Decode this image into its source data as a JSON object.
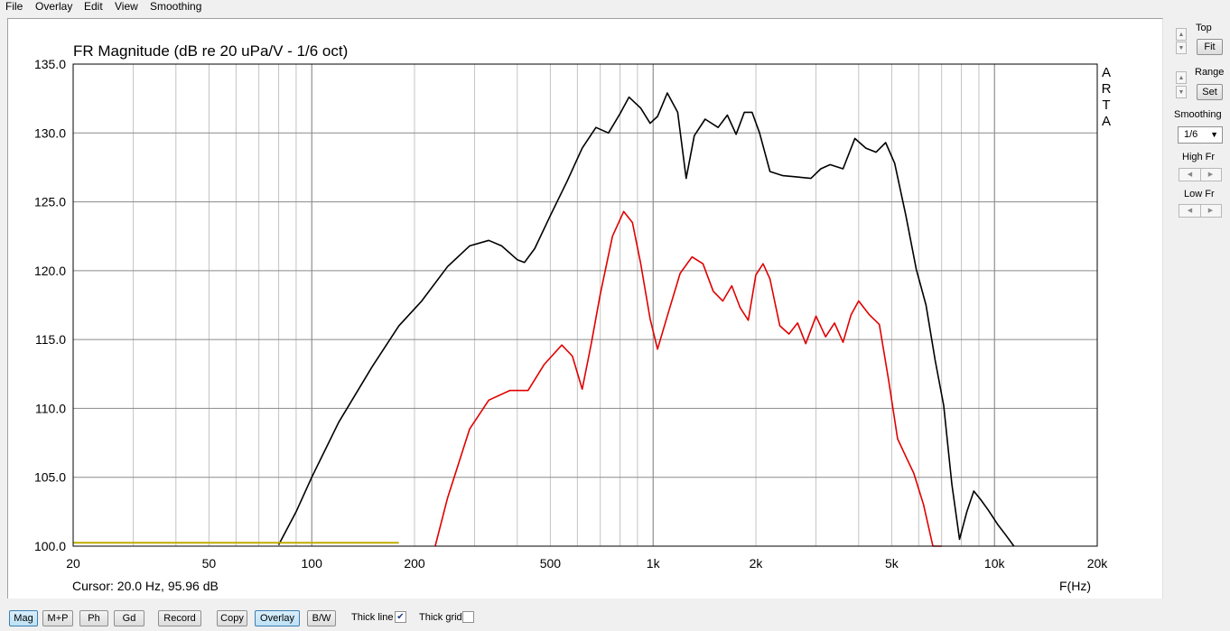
{
  "menu": [
    "File",
    "Overlay",
    "Edit",
    "View",
    "Smoothing"
  ],
  "chart_data": {
    "type": "line",
    "title": "FR Magnitude (dB re 20 uPa/V - 1/6 oct)",
    "xlabel": "F(Hz)",
    "ylabel": "",
    "watermark": [
      "A",
      "R",
      "T",
      "A"
    ],
    "cursor_text": "Cursor: 20.0 Hz, 95.96 dB",
    "x_scale": "log",
    "xlim": [
      20,
      20000
    ],
    "ylim": [
      100,
      135
    ],
    "x_ticks": [
      20,
      50,
      100,
      200,
      500,
      1000,
      2000,
      5000,
      10000,
      20000
    ],
    "x_tick_labels": [
      "20",
      "50",
      "100",
      "200",
      "500",
      "1k",
      "2k",
      "5k",
      "10k",
      "20k"
    ],
    "y_ticks": [
      100,
      105,
      110,
      115,
      120,
      125,
      130,
      135
    ],
    "y_tick_labels": [
      "100.0",
      "105.0",
      "110.0",
      "115.0",
      "120.0",
      "125.0",
      "130.0",
      "135.0"
    ],
    "grid": true,
    "background": "#ffffff",
    "series": [
      {
        "color": "#000000",
        "x": [
          80,
          90,
          100,
          120,
          150,
          180,
          210,
          250,
          290,
          330,
          360,
          400,
          420,
          450,
          500,
          560,
          620,
          680,
          740,
          800,
          850,
          920,
          980,
          1030,
          1100,
          1180,
          1250,
          1320,
          1420,
          1550,
          1650,
          1750,
          1850,
          1950,
          2050,
          2200,
          2400,
          2650,
          2900,
          3100,
          3300,
          3600,
          3900,
          4200,
          4500,
          4800,
          5100,
          5500,
          5900,
          6300,
          6700,
          7100,
          7500,
          7900,
          8300,
          8700,
          9100,
          9600,
          10200,
          10800,
          11400
        ],
        "y": [
          100.1,
          102.5,
          105,
          109,
          113,
          116,
          117.8,
          120.3,
          121.8,
          122.2,
          121.8,
          120.8,
          120.6,
          121.6,
          124,
          126.5,
          128.9,
          130.4,
          130,
          131.4,
          132.6,
          131.8,
          130.7,
          131.2,
          132.9,
          131.5,
          126.7,
          129.8,
          131,
          130.4,
          131.3,
          129.9,
          131.5,
          131.5,
          130,
          127.2,
          126.9,
          126.8,
          126.7,
          127.4,
          127.7,
          127.4,
          129.6,
          128.9,
          128.6,
          129.3,
          127.8,
          124,
          120.1,
          117.5,
          113.5,
          110.2,
          104.5,
          100.5,
          102.5,
          104,
          103.4,
          102.6,
          101.6,
          100.8,
          100
        ]
      },
      {
        "color": "#e00000",
        "x": [
          230,
          250,
          290,
          330,
          380,
          430,
          480,
          540,
          580,
          620,
          660,
          700,
          760,
          820,
          870,
          920,
          980,
          1030,
          1100,
          1200,
          1300,
          1400,
          1500,
          1600,
          1700,
          1800,
          1900,
          2000,
          2100,
          2200,
          2350,
          2500,
          2650,
          2800,
          3000,
          3200,
          3400,
          3600,
          3800,
          4000,
          4300,
          4600,
          4900,
          5200,
          5500,
          5800,
          6200,
          6600,
          7000
        ],
        "y": [
          100,
          103.5,
          108.5,
          110.6,
          111.3,
          111.3,
          113.2,
          114.6,
          113.8,
          111.4,
          114.8,
          118.3,
          122.5,
          124.3,
          123.5,
          120.5,
          116.5,
          114.3,
          116.7,
          119.8,
          121,
          120.5,
          118.5,
          117.8,
          118.9,
          117.3,
          116.4,
          119.7,
          120.5,
          119.4,
          116,
          115.4,
          116.2,
          114.7,
          116.7,
          115.2,
          116.2,
          114.8,
          116.8,
          117.8,
          116.8,
          116.1,
          112,
          107.8,
          106.5,
          105.3,
          103,
          100,
          100
        ]
      },
      {
        "color": "#c0ac00",
        "x": [
          20,
          180
        ],
        "y": [
          100.25,
          100.25
        ]
      }
    ]
  },
  "side": {
    "top_label": "Top",
    "fit_label": "Fit",
    "range_label": "Range",
    "set_label": "Set",
    "smoothing_label": "Smoothing",
    "smoothing_value": "1/6",
    "high_fr_label": "High Fr",
    "low_fr_label": "Low Fr"
  },
  "toolbar": {
    "mag": "Mag",
    "mp": "M+P",
    "ph": "Ph",
    "gd": "Gd",
    "record": "Record",
    "copy": "Copy",
    "overlay": "Overlay",
    "bw": "B/W",
    "thick_line": "Thick line",
    "thick_grid": "Thick grid"
  }
}
